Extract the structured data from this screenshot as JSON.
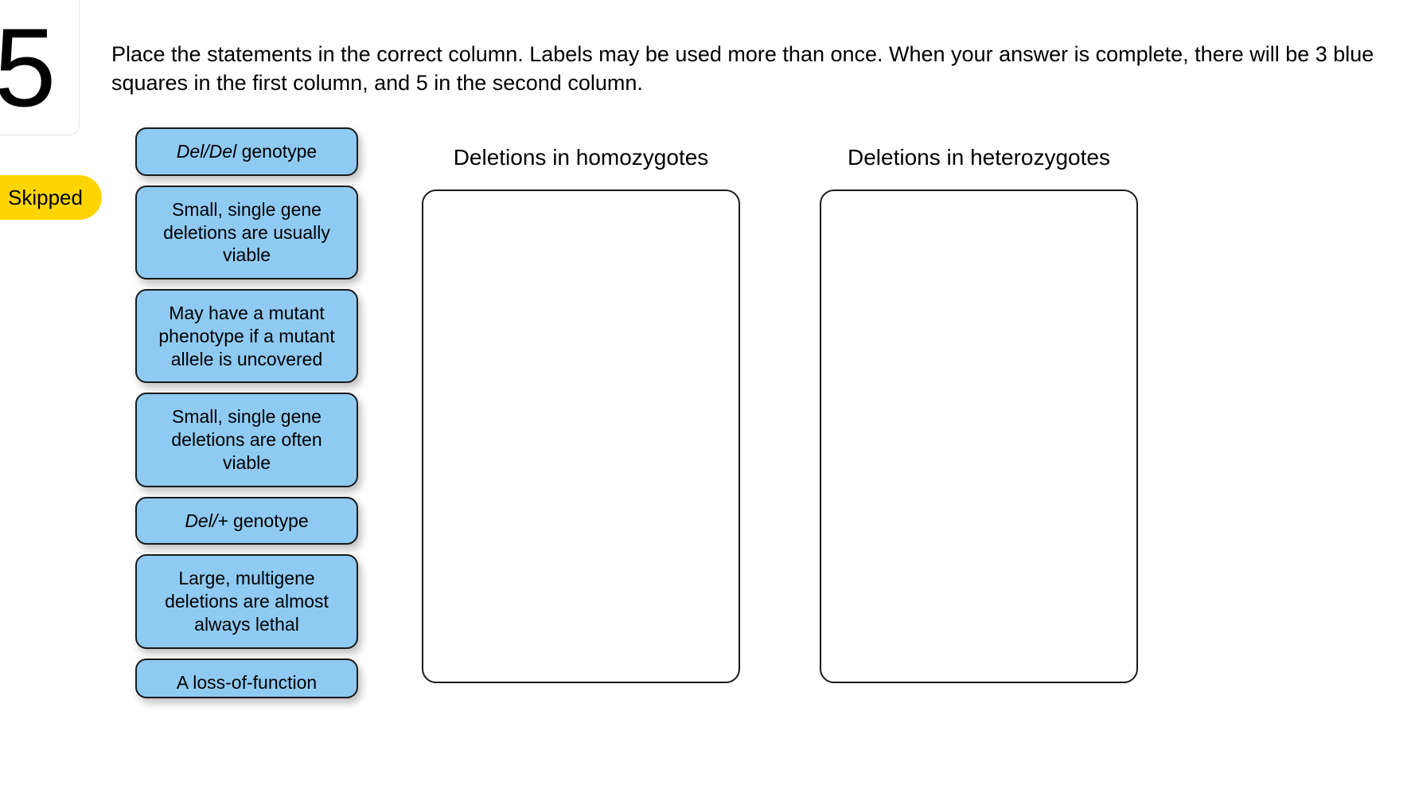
{
  "question_number": "5",
  "status": "Skipped",
  "instructions": "Place the statements in the correct column. Labels may be used more than once. When your answer is complete, there will be 3 blue squares in the first column, and 5 in the second column.",
  "labels": [
    {
      "prefix_italic": "Del/Del",
      "rest": " genotype"
    },
    {
      "text": "Small, single gene deletions are usually viable"
    },
    {
      "text": "May have a mutant phenotype if a mutant allele is uncovered"
    },
    {
      "text": "Small, single gene deletions are often viable"
    },
    {
      "prefix_italic": "Del/+",
      "rest": " genotype"
    },
    {
      "text": "Large, multigene deletions are almost always lethal"
    },
    {
      "text": "A loss-of-function"
    }
  ],
  "targets": [
    {
      "title": "Deletions in homozygotes"
    },
    {
      "title": "Deletions in heterozygotes"
    }
  ]
}
